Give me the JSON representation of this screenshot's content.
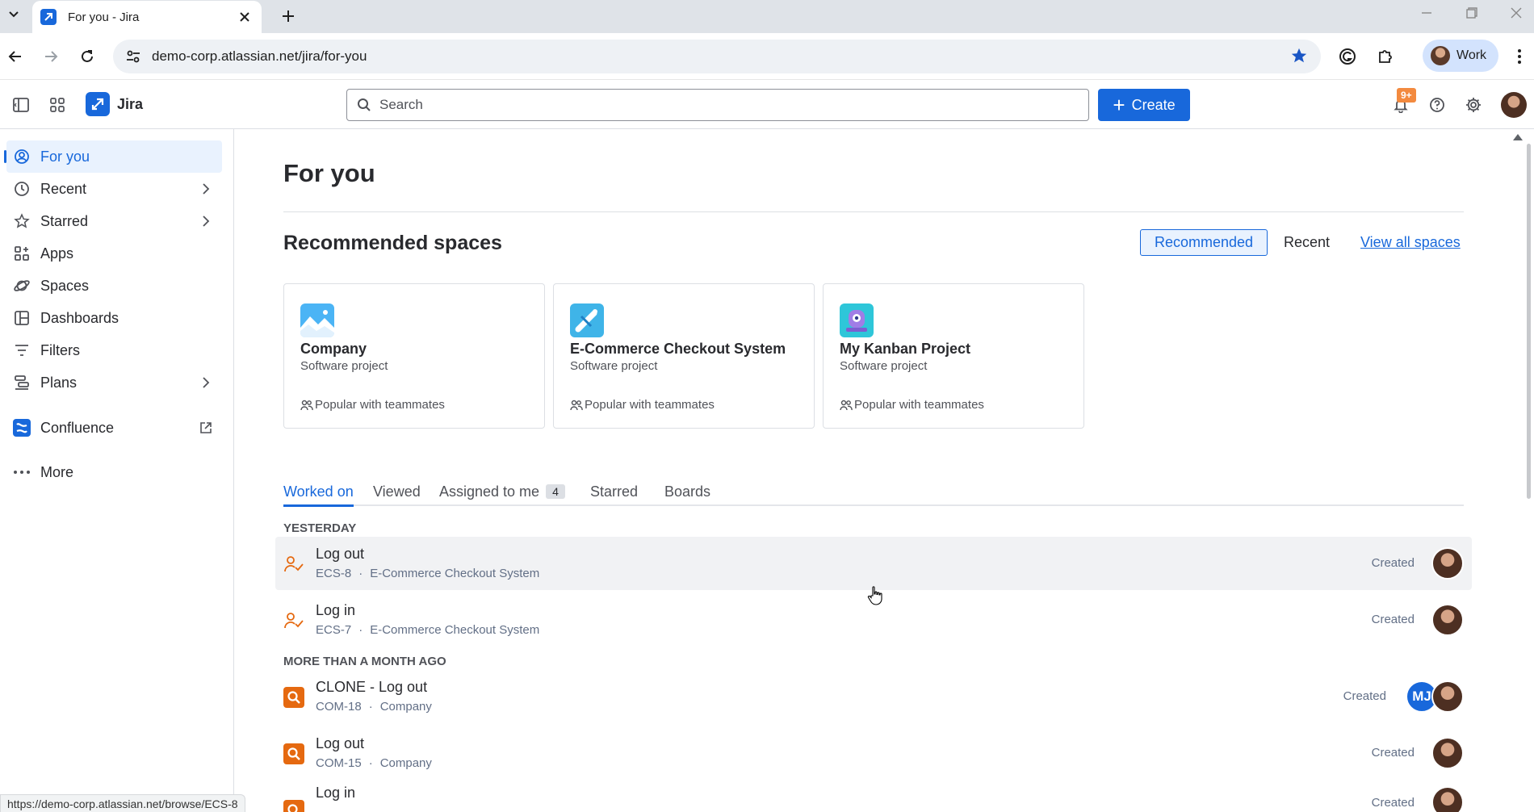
{
  "browser": {
    "tab_title": "For you - Jira",
    "url": "demo-corp.atlassian.net/jira/for-you",
    "profile_label": "Work",
    "status_url": "https://demo-corp.atlassian.net/browse/ECS-8"
  },
  "topnav": {
    "app_name": "Jira",
    "search_placeholder": "Search",
    "create_label": "Create",
    "notifications_badge": "9+"
  },
  "sidebar": {
    "items": [
      {
        "label": "For you",
        "icon": "user-circle-icon",
        "active": true
      },
      {
        "label": "Recent",
        "icon": "clock-icon",
        "has_chevron": true
      },
      {
        "label": "Starred",
        "icon": "star-icon",
        "has_chevron": true
      },
      {
        "label": "Apps",
        "icon": "apps-icon"
      },
      {
        "label": "Spaces",
        "icon": "planet-icon"
      },
      {
        "label": "Dashboards",
        "icon": "dashboard-icon"
      },
      {
        "label": "Filters",
        "icon": "filter-icon"
      },
      {
        "label": "Plans",
        "icon": "plans-icon",
        "has_chevron": true
      },
      {
        "label": "Confluence",
        "icon": "confluence-icon",
        "external": true
      },
      {
        "label": "More",
        "icon": "more-dots-icon"
      }
    ]
  },
  "main": {
    "title": "For you",
    "recommended": {
      "heading": "Recommended spaces",
      "toggle_recommended": "Recommended",
      "toggle_recent": "Recent",
      "view_all": "View all spaces",
      "cards": [
        {
          "name": "Company",
          "type": "Software project",
          "popular": "Popular with teammates",
          "icon": "company-space-icon"
        },
        {
          "name": "E-Commerce Checkout System",
          "type": "Software project",
          "popular": "Popular with teammates",
          "icon": "ecommerce-space-icon"
        },
        {
          "name": "My Kanban Project",
          "type": "Software project",
          "popular": "Popular with teammates",
          "icon": "kanban-space-icon"
        }
      ]
    },
    "tabs": [
      {
        "label": "Worked on",
        "active": true
      },
      {
        "label": "Viewed"
      },
      {
        "label": "Assigned to me",
        "count": "4"
      },
      {
        "label": "Starred"
      },
      {
        "label": "Boards"
      }
    ],
    "groups": [
      {
        "heading": "YESTERDAY",
        "items": [
          {
            "title": "Log out",
            "key": "ECS-8",
            "project": "E-Commerce Checkout System",
            "action": "Created",
            "icon": "user-check-icon"
          },
          {
            "title": "Log in",
            "key": "ECS-7",
            "project": "E-Commerce Checkout System",
            "action": "Created",
            "icon": "user-check-icon"
          }
        ]
      },
      {
        "heading": "MORE THAN A MONTH AGO",
        "items": [
          {
            "title": "CLONE - Log out",
            "key": "COM-18",
            "project": "Company",
            "action": "Created",
            "icon": "search-issue-icon",
            "extra_avatar": "MJ"
          },
          {
            "title": "Log out",
            "key": "COM-15",
            "project": "Company",
            "action": "Created",
            "icon": "search-issue-icon"
          },
          {
            "title": "Log in",
            "key": "",
            "project": "",
            "action": "Created",
            "icon": "search-issue-icon"
          }
        ]
      }
    ],
    "meta_separator": "·"
  },
  "colors": {
    "brand": "#1868db",
    "issue_orange": "#e56910",
    "badge_orange": "#f38a3f"
  }
}
